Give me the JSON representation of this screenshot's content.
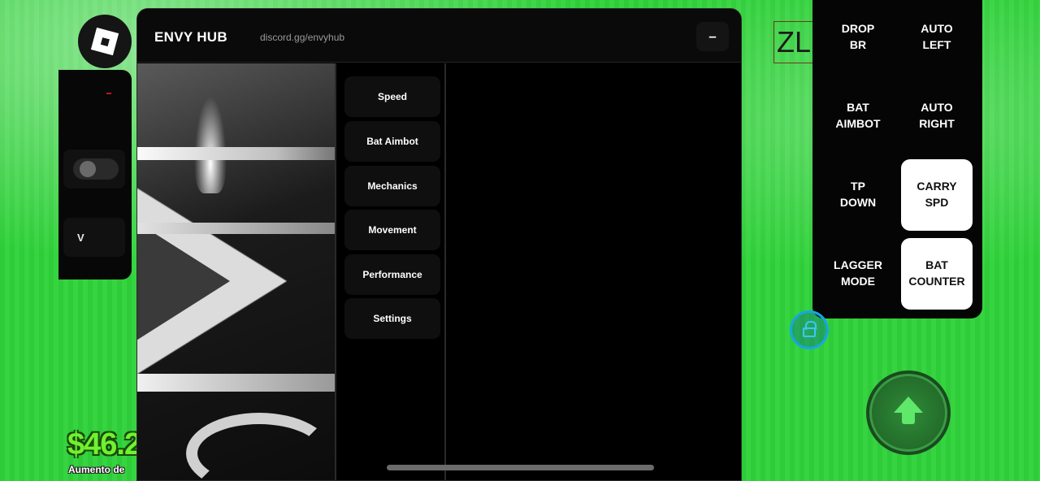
{
  "hud": {
    "left_key": "V",
    "money": "$46.2",
    "money_sub": "Aumento de",
    "zl_label": "ZL"
  },
  "window": {
    "title": "ENVY HUB",
    "link": "discord.gg/envyhub",
    "minimize": "–"
  },
  "sidebar": {
    "items": [
      {
        "label": "Speed"
      },
      {
        "label": "Bat Aimbot"
      },
      {
        "label": "Mechanics"
      },
      {
        "label": "Movement"
      },
      {
        "label": "Performance"
      },
      {
        "label": "Settings"
      }
    ]
  },
  "binds": {
    "items": [
      {
        "label": "DROP\nBR",
        "active": false
      },
      {
        "label": "AUTO\nLEFT",
        "active": false
      },
      {
        "label": "BAT\nAIMBOT",
        "active": false
      },
      {
        "label": "AUTO\nRIGHT",
        "active": false
      },
      {
        "label": "TP\nDOWN",
        "active": false
      },
      {
        "label": "CARRY\nSPD",
        "active": true
      },
      {
        "label": "LAGGER\nMODE",
        "active": false
      },
      {
        "label": "BAT\nCOUNTER",
        "active": true
      }
    ]
  },
  "icons": {
    "roblox": "roblox-logo-icon",
    "lock": "lock-icon",
    "jump": "jump-arrow-icon"
  },
  "colors": {
    "background_green": "#2fd33a",
    "money_green": "#6ff230",
    "lock_blue": "#17a6e4"
  }
}
